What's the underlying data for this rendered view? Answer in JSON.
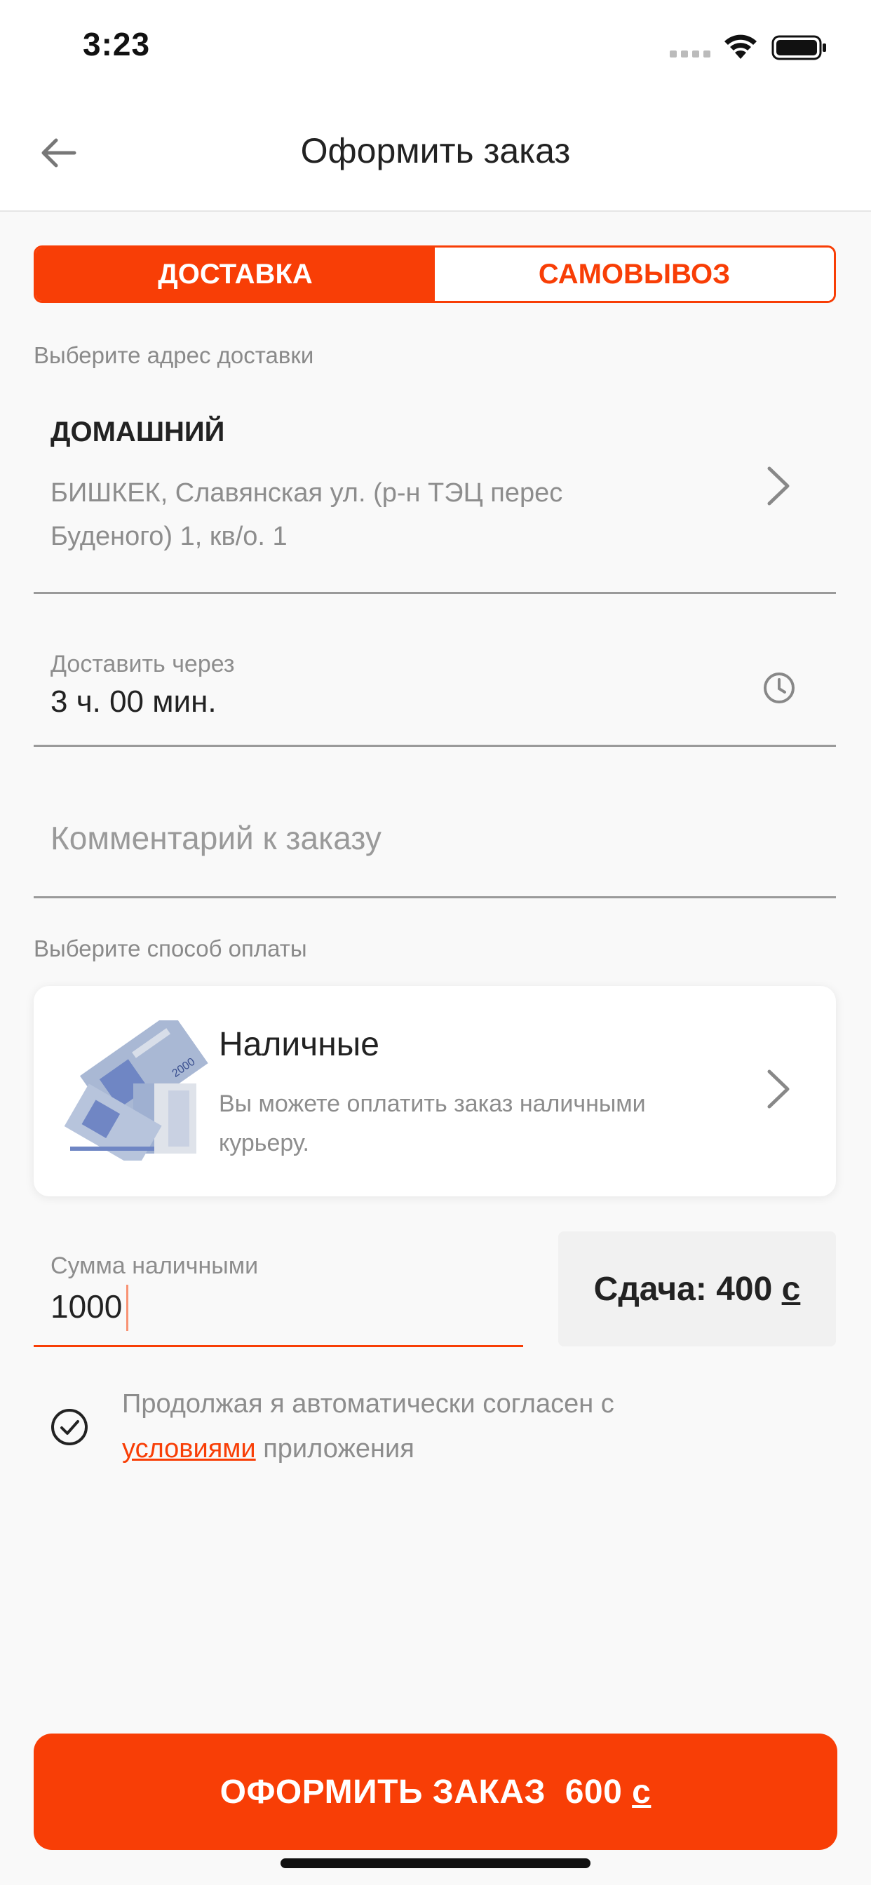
{
  "status_bar": {
    "time": "3:23"
  },
  "header": {
    "title": "Оформить заказ",
    "back_icon": "arrow-left-icon"
  },
  "tabs": [
    {
      "label": "ДОСТАВКА",
      "active": true
    },
    {
      "label": "САМОВЫВОЗ",
      "active": false
    }
  ],
  "address_section": {
    "label": "Выберите адрес доставки",
    "name": "ДОМАШНИЙ",
    "address": "БИШКЕК, Славянская ул. (р-н ТЭЦ перес Буденого) 1, кв/о. 1"
  },
  "delivery_time": {
    "label": "Доставить через",
    "value": "3 ч. 00 мин."
  },
  "comment": {
    "placeholder": "Комментарий к заказу"
  },
  "payment_section": {
    "label": "Выберите способ оплаты",
    "method_title": "Наличные",
    "method_desc": "Вы можете оплатить заказ наличными курьеру.",
    "banknote_label": "2000"
  },
  "cash": {
    "label": "Сумма наличными",
    "value": "1000",
    "change_prefix": "Сдача: 400",
    "currency": "с"
  },
  "agreement": {
    "text_before": "Продолжая я автоматически согласен с",
    "link": "условиями",
    "text_after": "приложения"
  },
  "order_button": {
    "label": "ОФОРМИТЬ ЗАКАЗ  600",
    "currency": "с"
  },
  "colors": {
    "accent": "#f83e06",
    "background": "#f9f9f9"
  }
}
